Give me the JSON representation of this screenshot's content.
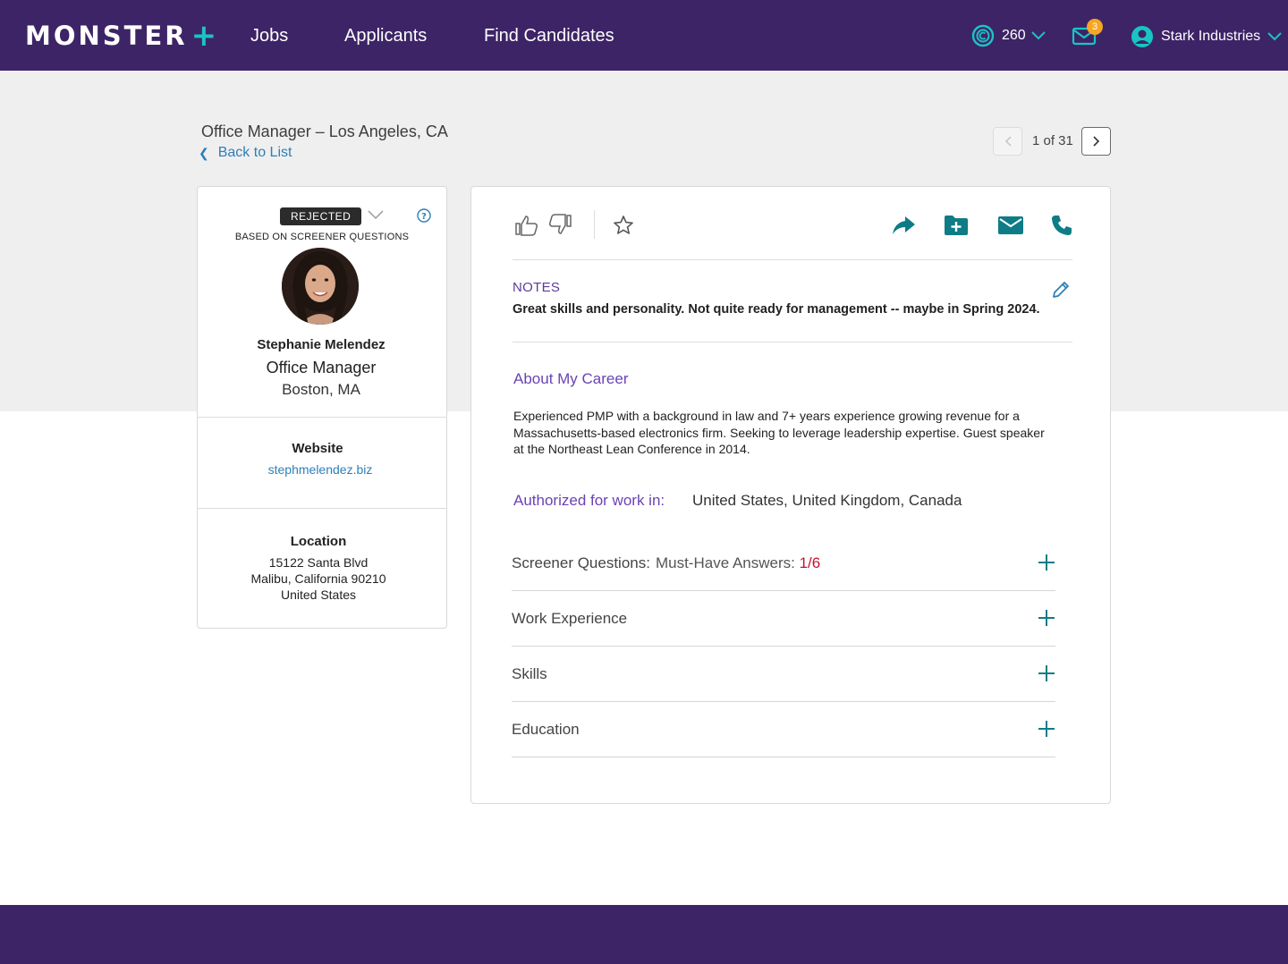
{
  "brand": {
    "logo_text": "MONSTER",
    "logo_plus": "+",
    "primary_color": "#3d2466",
    "accent_color": "#19c5c3",
    "link_color": "#2d7fb8"
  },
  "nav": {
    "links": [
      "Jobs",
      "Applicants",
      "Find Candidates"
    ],
    "credits": "260",
    "mail_badge": "3",
    "account_name": "Stark Industries"
  },
  "header": {
    "job_title": "Office Manager – Los Angeles, CA",
    "back_label": "Back to List",
    "pager_text": "1 of 31"
  },
  "candidate": {
    "status": "REJECTED",
    "status_reason": "BASED ON SCREENER QUESTIONS",
    "name": "Stephanie Melendez",
    "title": "Office Manager",
    "location": "Boston, MA",
    "website_label": "Website",
    "website": "stephmelendez.biz",
    "location_label": "Location",
    "address": [
      "15122 Santa Blvd",
      "Malibu, California 90210",
      "United States"
    ]
  },
  "detail": {
    "notes_label": "NOTES",
    "notes_text": "Great skills and personality. Not quite ready for management -- maybe in Spring 2024.",
    "about_heading": "About My Career",
    "about_text": "Experienced PMP with a background in law and 7+ years experience growing revenue for a Massachusetts-based electronics firm. Seeking to leverage leadership expertise. Guest speaker at the Northeast Lean Conference in 2014.",
    "authorized_label": "Authorized for work in:",
    "authorized_value": "United States, United Kingdom, Canada",
    "sections": [
      {
        "title": "Screener Questions:",
        "sub": "Must-Have Answers:",
        "value": "1/6"
      },
      {
        "title": "Work Experience"
      },
      {
        "title": "Skills"
      },
      {
        "title": "Education"
      }
    ]
  },
  "icons": {
    "toolbar": [
      "thumbs-up-icon",
      "thumbs-down-icon",
      "star-icon",
      "share-icon",
      "add-to-folder-icon",
      "email-icon",
      "phone-icon"
    ],
    "nav": [
      "credits-icon",
      "mail-icon",
      "account-icon",
      "chevron-down-icon"
    ]
  }
}
